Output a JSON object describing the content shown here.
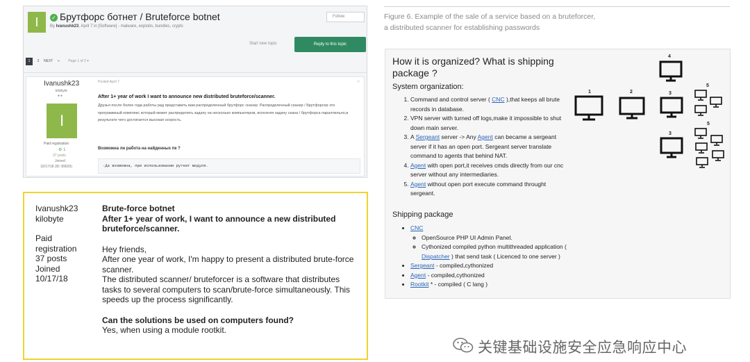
{
  "forum": {
    "avatar_letter": "I",
    "title": "Брутфорс ботнет / Bruteforce botnet",
    "byline_author": "Ivanushk23",
    "byline_rest": ", April 7 in [Software] - malware, exploits, bundles, crypts",
    "follow_label": "Follow",
    "start_topic": "Start new topic",
    "reply_label": "Reply to this topic",
    "pager": {
      "pages": [
        "1",
        "2"
      ],
      "next": "NEXT",
      "last": "»",
      "page_of": "Page 1 of 2 ▾"
    },
    "post": {
      "username": "Ivanushk23",
      "level": "kilobyte",
      "level_dots": "●●",
      "avatar_letter": "I",
      "group": "Paid registration",
      "reputation": "1",
      "posts": "37 posts",
      "joined_label": "Joined",
      "joined_value": "10/17/18 (ID: 89629)",
      "posted": "Posted April 7",
      "share": "<",
      "headline": "After 1+ year of work I want to announce new distributed bruteforce/scanner.",
      "ru_text": "Друзья после более года работы рад представить вам распределенный брутфорс сканер. Распределенный сканер / Брутфорсер это программный комплекс который может распределить задачу на несколько компьютеров, исполняя задачу скана / брутфорса параллельно,в результате чего достигается высокая скорость.",
      "question": "Возможна ли работа на найденных пк ?",
      "code": "-Да возможна, при использовании руткит модуля."
    }
  },
  "translation": {
    "user_lines": [
      "Ivanushk23",
      "kilobyte"
    ],
    "meta_lines": [
      "Paid",
      "registration",
      "37 posts",
      "Joined",
      "10/17/18"
    ],
    "title": "Brute-force botnet",
    "headline": "After 1+ year of work, I want to announce a new distributed bruteforce/scanner.",
    "greeting": "Hey friends,",
    "p1": "After one year of work, I'm happy to present a distributed brute-force scanner.",
    "p2": "The distributed scanner/ bruteforcer is a software that distributes tasks to several computers to scan/brute-force simultaneously. This speeds up the process significantly.",
    "question": "Can the solutions be used on computers found?",
    "answer": "Yes, when using a module rootkit."
  },
  "caption": {
    "line1": "Figure 6. Example of the sale of a service based on a bruteforcer,",
    "line2": "a distributed scanner for establishing passwords"
  },
  "slide": {
    "heading": "How it is organized? What is shipping package ?",
    "system_heading": "System organization:",
    "items": [
      {
        "pre": "Command and control server ( ",
        "link": "CNC",
        "post": " ),that keeps all brute records in database."
      },
      {
        "pre": "VPN server with turned off logs,make it impossible to shut down main server.",
        "link": "",
        "post": ""
      },
      {
        "pre": "A ",
        "link": "Sergeant",
        "post": " server -> Any ",
        "link2": "Agent",
        "post2": " can became a sergeant server if it has an open port. Sergeant server translate command to agents that behind NAT."
      },
      {
        "pre": "",
        "link": "Agent",
        "post": " with open port,it receives cmds directly from our cnc server without any intermediaries."
      },
      {
        "pre": "",
        "link": "Agent",
        "post": " without open port execute command throught sergeant."
      }
    ],
    "shipping_heading": "Shipping package",
    "cnc_link": "CNC",
    "cnc_sub1": "OpenSource PHP UI Admin Panel.",
    "cnc_sub2_pre": "Cythonized compiled python multithreaded application ( ",
    "cnc_sub2_link": "Dispatcher",
    "cnc_sub2_post": " ) that send task ( Licenced to one server )",
    "ship_sergeant_link": "Sergeant",
    "ship_sergeant_text": " - compiled,cythonized",
    "ship_agent_link": "Agent",
    "ship_agent_text": " - compiled,cythonized",
    "ship_rootkit_link": "Rootkit",
    "ship_rootkit_text": " * - compiled ( C lang )",
    "node_labels": {
      "n1": "1",
      "n2": "2",
      "n3a": "3",
      "n3b": "3",
      "n4": "4",
      "n5a": "5",
      "n5b": "5"
    }
  },
  "watermark": {
    "text": "关键基础设施安全应急响应中心",
    "icon": "wechat-icon"
  },
  "colors": {
    "reply_button": "#2f8a62",
    "avatar": "#8fb84a",
    "translation_border": "#f0d230",
    "link": "#2a63b8"
  }
}
